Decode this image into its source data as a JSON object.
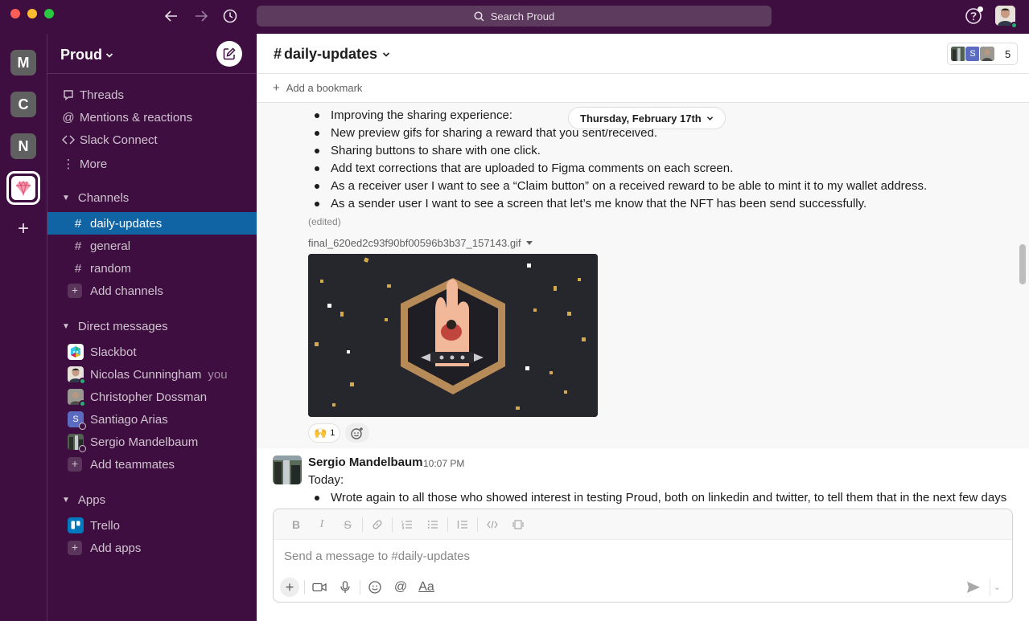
{
  "window": {
    "search_placeholder": "Search Proud"
  },
  "rail": {
    "workspaces": [
      "M",
      "C",
      "N"
    ],
    "add_label": "+"
  },
  "sidebar": {
    "workspace_name": "Proud",
    "nav": [
      {
        "label": "Threads",
        "icon": "threads-icon"
      },
      {
        "label": "Mentions & reactions",
        "icon": "at-icon"
      },
      {
        "label": "Slack Connect",
        "icon": "slack-connect-icon"
      },
      {
        "label": "More",
        "icon": "more-vertical-icon"
      }
    ],
    "channels_header": "Channels",
    "channels": [
      "daily-updates",
      "general",
      "random"
    ],
    "add_channels": "Add channels",
    "dm_header": "Direct messages",
    "dms": [
      {
        "name": "Slackbot",
        "suffix": ""
      },
      {
        "name": "Nicolas Cunningham",
        "suffix": "you"
      },
      {
        "name": "Christopher Dossman",
        "suffix": ""
      },
      {
        "name": "Santiago Arias",
        "suffix": ""
      },
      {
        "name": "Sergio Mandelbaum",
        "suffix": ""
      }
    ],
    "add_teammates": "Add teammates",
    "apps_header": "Apps",
    "apps": [
      "Trello"
    ],
    "add_apps": "Add apps"
  },
  "channel": {
    "hash": "#",
    "name": "daily-updates",
    "member_count": "5",
    "member_initial": "S",
    "add_bookmark": "Add a bookmark"
  },
  "messages": {
    "date_divider": "Thursday, February 17th",
    "msg1": {
      "bullets": [
        "Improving the sharing experience:",
        "New preview gifs for sharing a reward that you sent/received.",
        "Sharing buttons to share with one click.",
        "Add text corrections that are uploaded to Figma comments on each screen.",
        "As a receiver user I want to see a “Claim button” on a received reward to be able to mint it to my wallet address.",
        "As a sender user I want to see a screen that let’s me know that the NFT has been send successfully."
      ],
      "edited": "(edited)",
      "attachment": "final_620ed2c93f90bf00596b3b37_157143.gif",
      "reaction_emoji": "🙌",
      "reaction_count": "1"
    },
    "msg2": {
      "author": "Sergio Mandelbaum",
      "time": "10:07 PM",
      "text": "Today:",
      "bullet": "Wrote again to all those who showed interest in testing Proud, both on linkedin and twitter, to tell them that in the next few days"
    }
  },
  "composer": {
    "placeholder": "Send a message to #daily-updates",
    "format_tools": [
      "B",
      "I",
      "S"
    ],
    "text_format_label": "Aa"
  },
  "colors": {
    "sidebar": "#3f0e40",
    "active_channel": "#1164a3",
    "online": "#2bac76"
  }
}
